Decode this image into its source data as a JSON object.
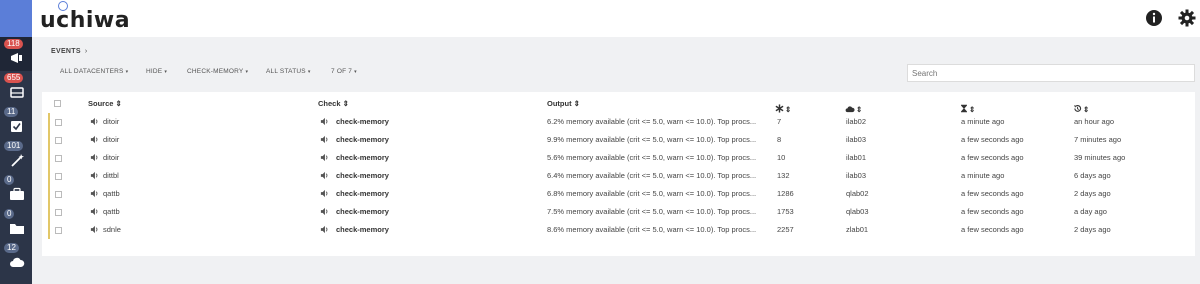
{
  "app": {
    "logo_text": "uchiwa"
  },
  "sidebar": {
    "items": [
      {
        "name": "events",
        "badge": "118",
        "icon": "megaphone-icon"
      },
      {
        "name": "clients",
        "badge": "655",
        "icon": "server-icon"
      },
      {
        "name": "checks",
        "badge": "11",
        "icon": "check-square-icon"
      },
      {
        "name": "stashes",
        "badge": "101",
        "icon": "magic-wand-icon"
      },
      {
        "name": "aggregates",
        "badge": "0",
        "icon": "briefcase-icon"
      },
      {
        "name": "silenced",
        "badge": "0",
        "icon": "folder-icon"
      },
      {
        "name": "datacenters",
        "badge": "12",
        "icon": "cloud-icon"
      }
    ]
  },
  "topbar": {
    "info_icon": "info-icon",
    "settings_icon": "gear-icon"
  },
  "breadcrumb": {
    "label": "EVENTS",
    "separator": "›"
  },
  "filters": {
    "datacenters": "ALL DATACENTERS",
    "hide": "HIDE",
    "check": "CHECK-MEMORY",
    "status": "ALL STATUS",
    "count": "7 OF 7"
  },
  "search": {
    "placeholder": "Search"
  },
  "table": {
    "headers": {
      "source": "Source ⇕",
      "check": "Check ⇕",
      "output": "Output ⇕",
      "occurrences": "⇕",
      "datacenter": "⇕",
      "last_seen": "⇕",
      "age": "⇕"
    },
    "rows": [
      {
        "source": "ditoir",
        "check": "check-memory",
        "output": "6.2% memory available (crit <= 5.0, warn <= 10.0). Top procs...",
        "occurrences": "7",
        "datacenter": "ilab02",
        "last_seen": "a minute ago",
        "age": "an hour ago"
      },
      {
        "source": "ditoir",
        "check": "check-memory",
        "output": "9.9% memory available (crit <= 5.0, warn <= 10.0). Top procs...",
        "occurrences": "8",
        "datacenter": "ilab03",
        "last_seen": "a few seconds ago",
        "age": "7 minutes ago"
      },
      {
        "source": "ditoir",
        "check": "check-memory",
        "output": "5.6% memory available (crit <= 5.0, warn <= 10.0). Top procs...",
        "occurrences": "10",
        "datacenter": "ilab01",
        "last_seen": "a few seconds ago",
        "age": "39 minutes ago"
      },
      {
        "source": "dittbl",
        "check": "check-memory",
        "output": "6.4% memory available (crit <= 5.0, warn <= 10.0). Top procs...",
        "occurrences": "132",
        "datacenter": "ilab03",
        "last_seen": "a minute ago",
        "age": "6 days ago"
      },
      {
        "source": "qattb",
        "check": "check-memory",
        "output": "6.8% memory available (crit <= 5.0, warn <= 10.0). Top procs...",
        "occurrences": "1286",
        "datacenter": "qlab02",
        "last_seen": "a few seconds ago",
        "age": "2 days ago"
      },
      {
        "source": "qattb",
        "check": "check-memory",
        "output": "7.5% memory available (crit <= 5.0, warn <= 10.0). Top procs...",
        "occurrences": "1753",
        "datacenter": "qlab03",
        "last_seen": "a few seconds ago",
        "age": "a day ago"
      },
      {
        "source": "sdnle",
        "check": "check-memory",
        "output": "8.6% memory available (crit <= 5.0, warn <= 10.0). Top procs...",
        "occurrences": "2257",
        "datacenter": "zlab01",
        "last_seen": "a few seconds ago",
        "age": "2 days ago"
      }
    ]
  },
  "colors": {
    "sidebar": "#2c3548",
    "accent": "#5b7ed8",
    "badge": "#d9534f",
    "warning_bar": "#e2c768"
  }
}
